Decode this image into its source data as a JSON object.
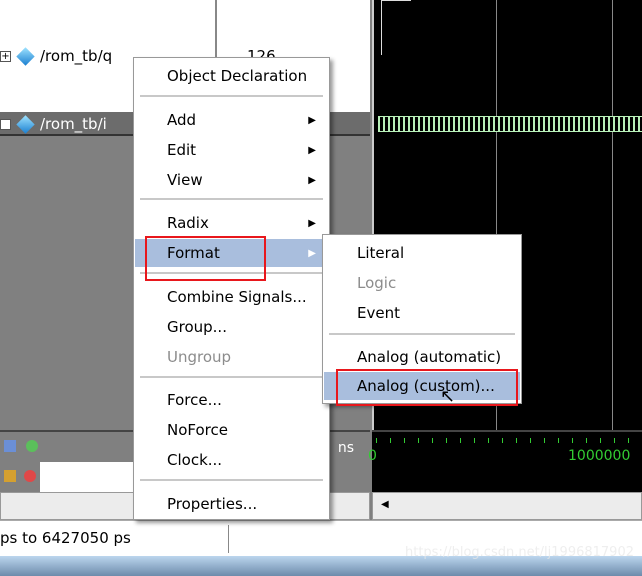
{
  "signals": [
    {
      "name": "/rom_tb/q",
      "value": "126"
    },
    {
      "name": "/rom_tb/i",
      "value": ""
    }
  ],
  "context_menu": {
    "items": [
      {
        "label": "Object Declaration"
      },
      {
        "label": "Add",
        "submenu": true
      },
      {
        "label": "Edit",
        "submenu": true
      },
      {
        "label": "View",
        "submenu": true
      },
      {
        "label": "Radix",
        "submenu": true
      },
      {
        "label": "Format",
        "submenu": true,
        "highlighted": true
      },
      {
        "label": "Combine Signals..."
      },
      {
        "label": "Group..."
      },
      {
        "label": "Ungroup",
        "disabled": true
      },
      {
        "label": "Force..."
      },
      {
        "label": "NoForce"
      },
      {
        "label": "Clock..."
      },
      {
        "label": "Properties..."
      }
    ]
  },
  "format_submenu": {
    "items": [
      {
        "label": "Literal"
      },
      {
        "label": "Logic",
        "disabled": true
      },
      {
        "label": "Event"
      },
      {
        "label": "Analog (automatic)"
      },
      {
        "label": "Analog (custom)...",
        "highlighted": true
      }
    ]
  },
  "toolbar": {
    "now_unit": "ns",
    "cursor_unit": "ns"
  },
  "ruler": {
    "labels": [
      "0",
      "1000000"
    ]
  },
  "status": {
    "range_text": "ps to 6427050 ps"
  },
  "watermark": "https://blog.csdn.net/lj1996817902",
  "colors": {
    "highlight": "#a9bedd",
    "annotation": "#e8171c",
    "wave_green": "#b8f0b8",
    "ruler_green": "#33cc33"
  }
}
